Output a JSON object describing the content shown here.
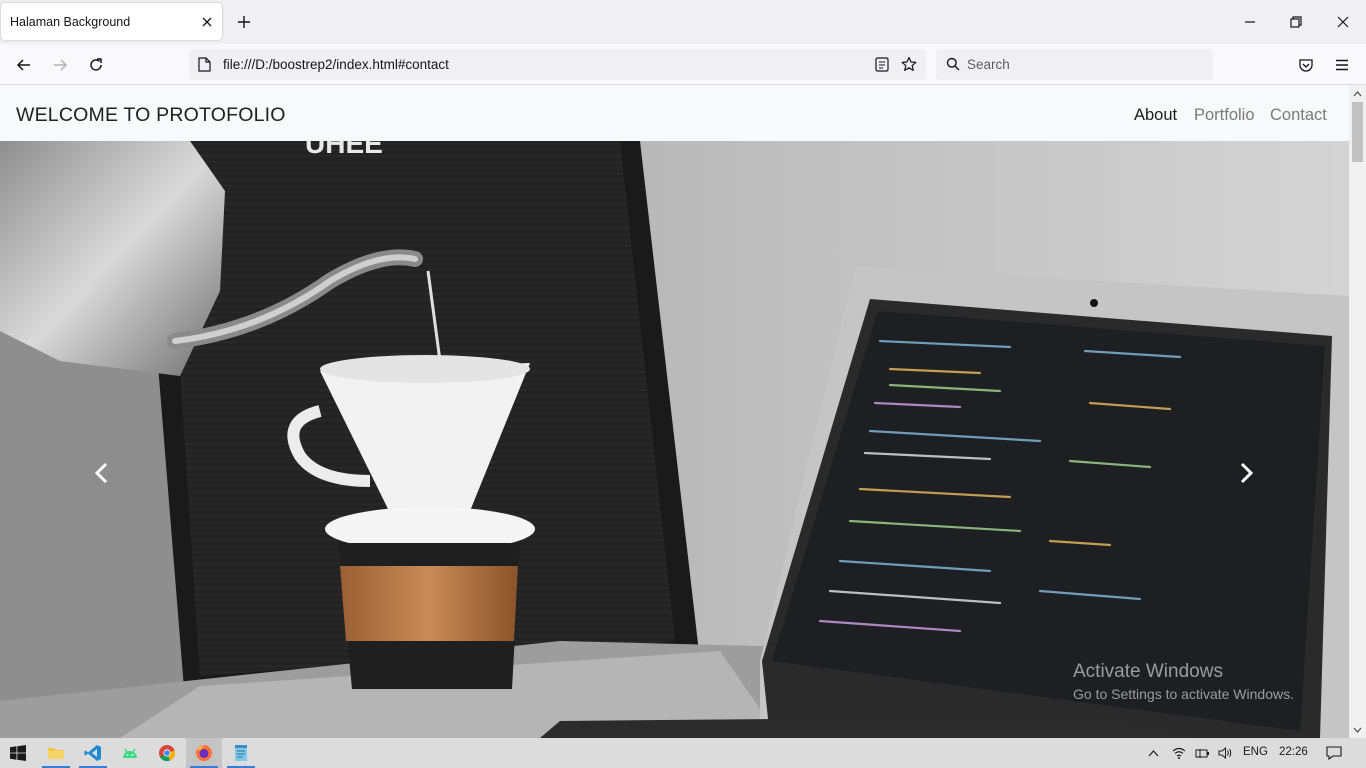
{
  "browser": {
    "tab": {
      "title": "Halaman Background"
    },
    "url": "file:///D:/boostrep2/index.html#contact",
    "search_placeholder": "Search"
  },
  "site": {
    "brand": "WELCOME TO PROTOFOLIO",
    "nav": [
      {
        "label": "About",
        "active": true
      },
      {
        "label": "Portfolio",
        "active": false
      },
      {
        "label": "Contact",
        "active": false
      }
    ],
    "carousel": {
      "prev_icon": "chevron-left-icon",
      "next_icon": "chevron-right-icon"
    }
  },
  "watermark": {
    "line1": "Activate Windows",
    "line2": "Go to Settings to activate Windows."
  },
  "taskbar": {
    "apps": [
      "start-icon",
      "file-explorer-icon",
      "vscode-icon",
      "android-studio-icon",
      "chrome-icon",
      "firefox-icon",
      "notepad-icon"
    ],
    "language": "ENG",
    "time": "22:26"
  }
}
